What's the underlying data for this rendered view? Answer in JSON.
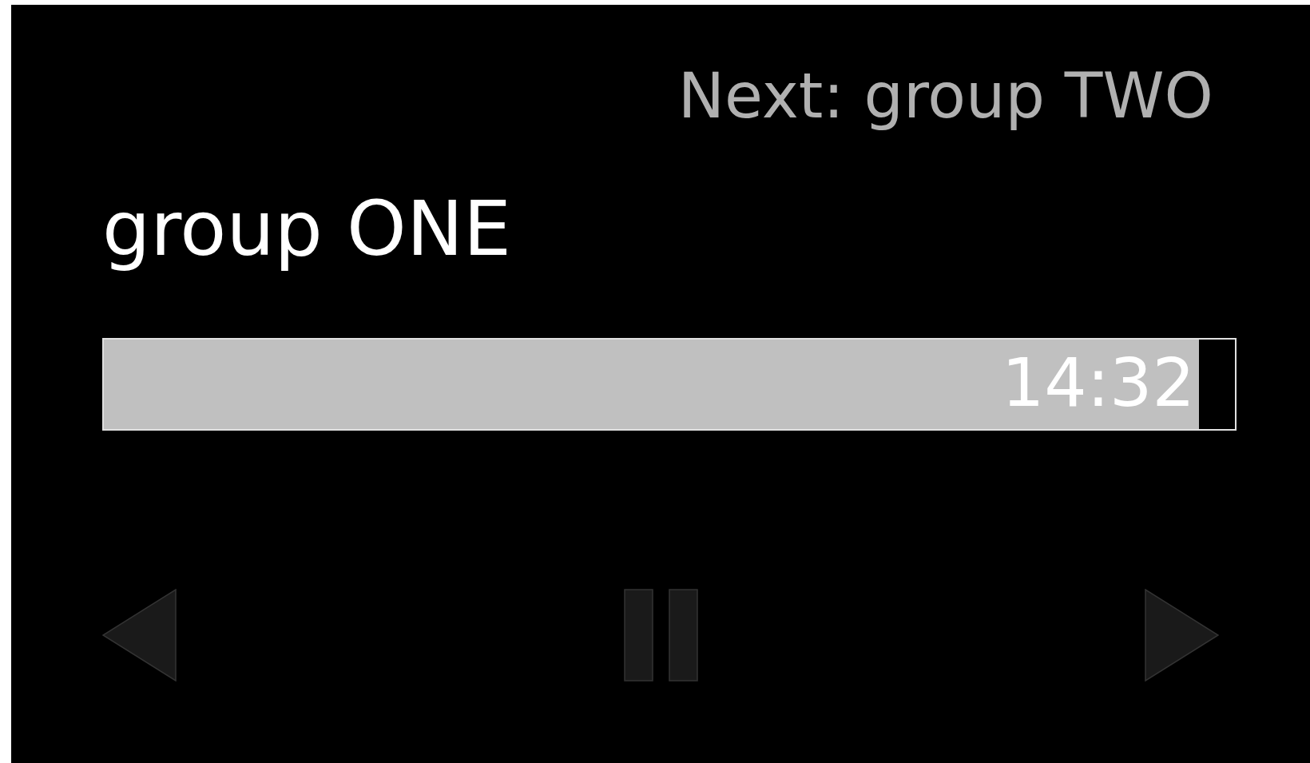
{
  "next_label": "Next: group TWO",
  "current_title": "group ONE",
  "progress": {
    "level": 0.968,
    "time": "14:32"
  },
  "controls": [
    {
      "kind": "previous"
    },
    {
      "kind": "pause"
    },
    {
      "kind": "next"
    }
  ]
}
